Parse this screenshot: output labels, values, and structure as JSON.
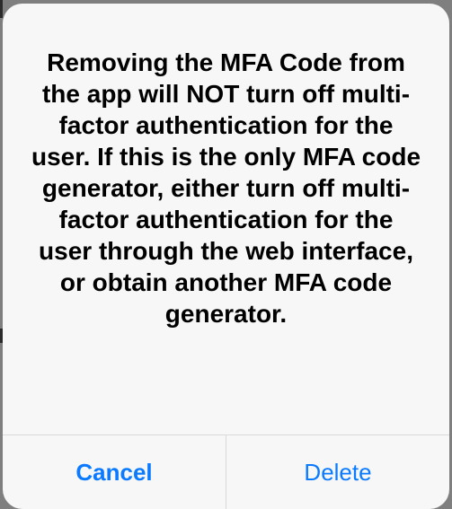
{
  "alert": {
    "message": "Removing the MFA Code from the app will NOT turn off multi-factor authentication for the user. If this is the only MFA code generator, either turn off multi-factor authentication for the user through the web interface, or obtain another MFA code generator.",
    "buttons": {
      "cancel_label": "Cancel",
      "delete_label": "Delete"
    }
  },
  "colors": {
    "accent": "#0a7aff",
    "alert_background": "#f7f7f7",
    "dimmed_backdrop": "#7f7f7f"
  }
}
